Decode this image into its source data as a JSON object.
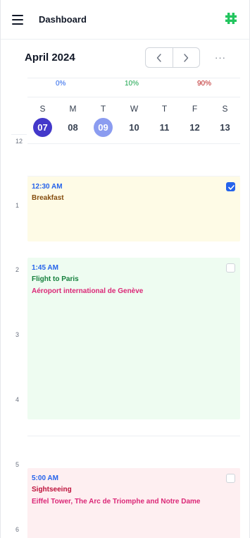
{
  "header": {
    "title": "Dashboard",
    "logo_icon": "hashtag-logo-icon",
    "logo_color": "#22c55e"
  },
  "calendar": {
    "month_label": "April 2024",
    "prev_icon": "chevron-left-icon",
    "next_icon": "chevron-right-icon",
    "more_label": "···"
  },
  "progress": [
    {
      "label": "0%",
      "color": "#2563eb"
    },
    {
      "label": "10%",
      "color": "#16a34a"
    },
    {
      "label": "90%",
      "color": "#b91c1c"
    }
  ],
  "week": {
    "days": [
      {
        "letter": "S",
        "number": "07",
        "state": "selected"
      },
      {
        "letter": "M",
        "number": "08",
        "state": "normal"
      },
      {
        "letter": "T",
        "number": "09",
        "state": "today"
      },
      {
        "letter": "W",
        "number": "10",
        "state": "normal"
      },
      {
        "letter": "T",
        "number": "11",
        "state": "normal"
      },
      {
        "letter": "F",
        "number": "12",
        "state": "normal"
      },
      {
        "letter": "S",
        "number": "13",
        "state": "normal"
      }
    ]
  },
  "timeline": {
    "hours": [
      "12",
      "1",
      "2",
      "3",
      "4",
      "5",
      "6"
    ]
  },
  "events": [
    {
      "time": "12:30 AM",
      "title": "Breakfast",
      "location": "",
      "checked": true,
      "bg_color": "#fefbe6",
      "title_color": "#854d0e"
    },
    {
      "time": "1:45 AM",
      "title": "Flight to Paris",
      "location": "Aéroport international de Genève",
      "checked": false,
      "bg_color": "#eefcf1",
      "title_color": "#15803d"
    },
    {
      "time": "5:00 AM",
      "title": "Sightseeing",
      "location": "Eiffel Tower, The Arc de Triomphe and Notre Dame",
      "checked": false,
      "bg_color": "#feeff1",
      "title_color": "#be123c"
    }
  ]
}
